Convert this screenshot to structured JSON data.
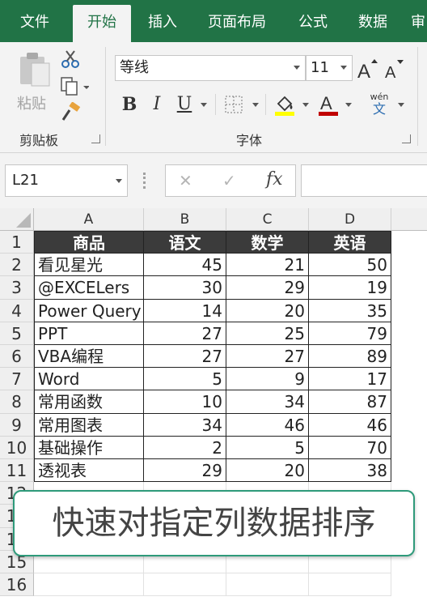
{
  "tabs": [
    "文件",
    "开始",
    "插入",
    "页面布局",
    "公式",
    "数据",
    "审"
  ],
  "ribbon": {
    "paste_label": "粘贴",
    "clipboard_label": "剪贴板",
    "font_group_label": "字体",
    "font_name": "等线",
    "font_size": "11",
    "bold": "B",
    "italic": "I",
    "underline": "U",
    "phonetic_top": "wén",
    "phonetic_char": "文",
    "font_color": "#c00000",
    "highlight_color": "#ffff00"
  },
  "formula_bar": {
    "name_box": "L21",
    "fx": "fx",
    "cancel": "✕",
    "enter": "✓",
    "value": ""
  },
  "sheet": {
    "columns": [
      "A",
      "B",
      "C",
      "D"
    ],
    "row_numbers": [
      "1",
      "2",
      "3",
      "4",
      "5",
      "6",
      "7",
      "8",
      "9",
      "10",
      "11",
      "12",
      "13",
      "14",
      "15",
      "16"
    ],
    "header": [
      "商品",
      "语文",
      "数学",
      "英语"
    ],
    "rows": [
      [
        "看见星光",
        "45",
        "21",
        "50"
      ],
      [
        "@EXCELers",
        "30",
        "29",
        "19"
      ],
      [
        "Power Query",
        "14",
        "20",
        "35"
      ],
      [
        "PPT",
        "27",
        "25",
        "79"
      ],
      [
        "VBA编程",
        "27",
        "27",
        "89"
      ],
      [
        "Word",
        "5",
        "9",
        "17"
      ],
      [
        "常用函数",
        "10",
        "34",
        "87"
      ],
      [
        "常用图表",
        "34",
        "46",
        "46"
      ],
      [
        "基础操作",
        "2",
        "5",
        "70"
      ],
      [
        "透视表",
        "29",
        "20",
        "38"
      ]
    ]
  },
  "caption": "快速对指定列数据排序",
  "colors": {
    "brand": "#217346",
    "header_fill": "#3b3b3b",
    "caption_border": "#2e9a7a"
  }
}
